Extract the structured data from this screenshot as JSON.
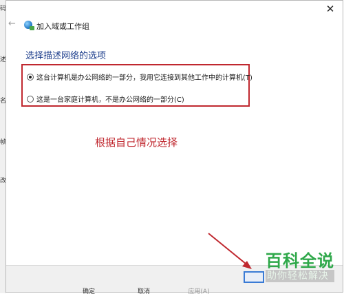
{
  "wizard": {
    "title": "加入域或工作组",
    "close_glyph": "✕",
    "back_glyph": "←"
  },
  "section": {
    "heading": "选择描述网络的选项"
  },
  "options": [
    {
      "label": "这台计算机是办公网络的一部分，我用它连接到其他工作中的计算机(T)",
      "checked": true
    },
    {
      "label": "这是一台家庭计算机，不是办公网络的一部分(C)",
      "checked": false
    }
  ],
  "annotation": {
    "text": "根据自己情况选择"
  },
  "footer_buttons": {
    "ok": "确定",
    "cancel": "取消",
    "apply": "应用(A)"
  },
  "background_window": {
    "fragments": [
      "码",
      "述",
      "名",
      "帧",
      "改"
    ]
  },
  "watermark": {
    "main": "百科全说",
    "sub": "助你轻松解决"
  },
  "colors": {
    "highlight_box": "#c0282f",
    "heading": "#1d3e8c",
    "annotation": "#c0282f",
    "watermark": "#2fa84a"
  },
  "icons": {
    "wizard": "globe-network-icon",
    "back": "back-arrow-icon",
    "close": "close-icon"
  }
}
